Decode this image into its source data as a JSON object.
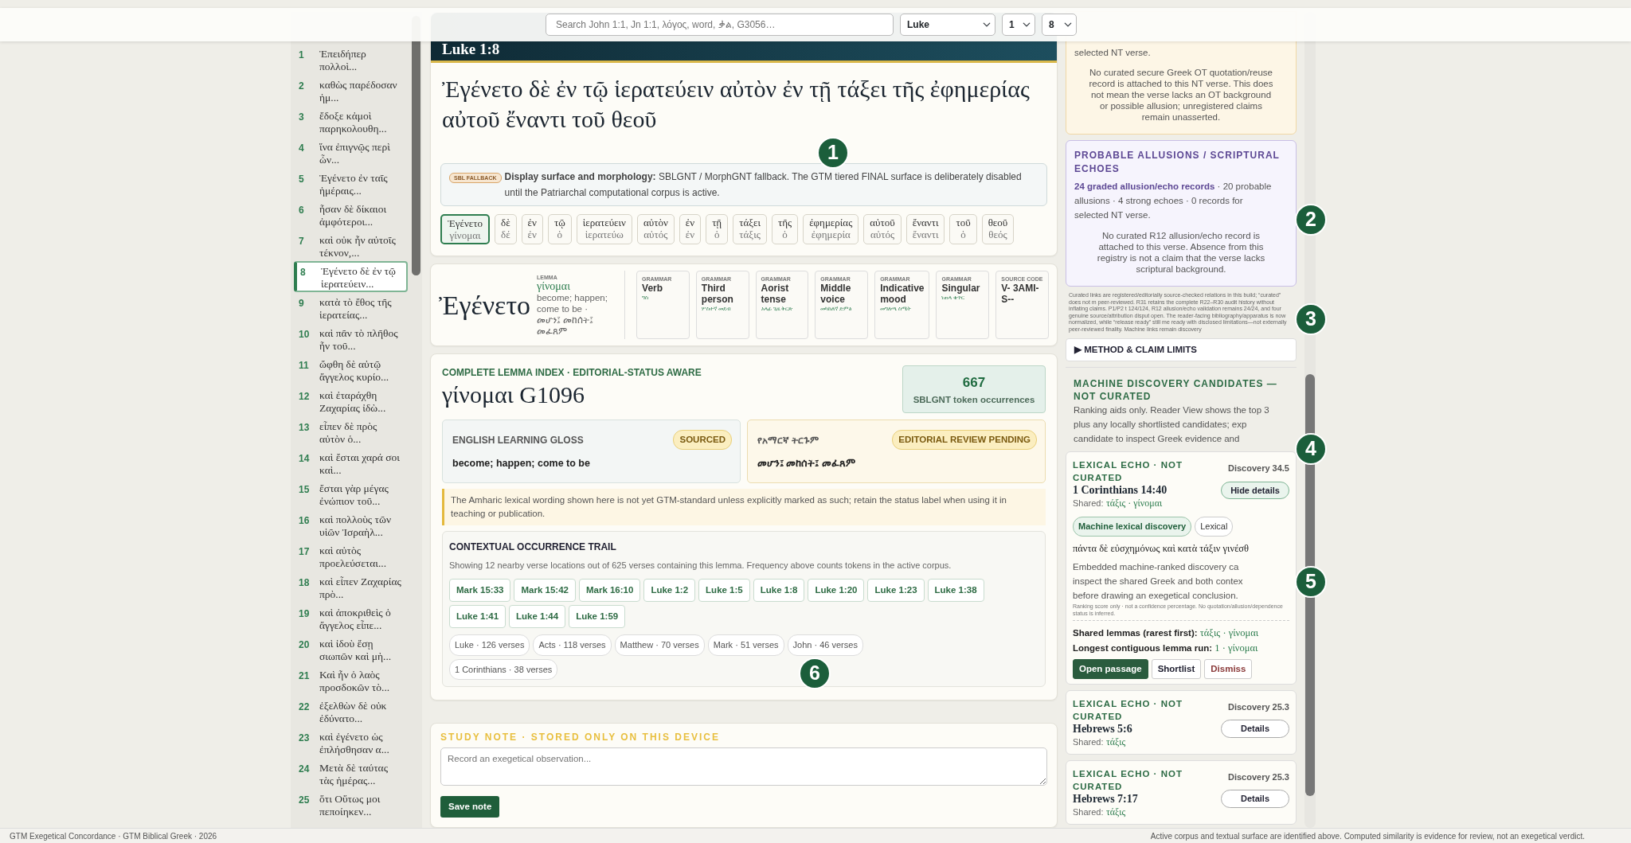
{
  "top_bar": {
    "search": {
      "placeholder": "Search John 1:1, Jn 1:1, λόγος, word, ቃል, G3056…"
    },
    "book": "Luke",
    "chapter": "1",
    "verse": "8"
  },
  "sidebar": {
    "verses": [
      {
        "number": "1",
        "text": "Ἐπειδήπερ πολλοὶ...",
        "selected": false
      },
      {
        "number": "2",
        "text": "καθὼς παρέδοσαν ἡμ...",
        "selected": false
      },
      {
        "number": "3",
        "text": "ἔδοξε κἀμοὶ παρηκολουθη...",
        "selected": false
      },
      {
        "number": "4",
        "text": "ἵνα ἐπιγνῷς περὶ ὧν...",
        "selected": false
      },
      {
        "number": "5",
        "text": "Ἐγένετο ἐν ταῖς ἡμέραις...",
        "selected": false
      },
      {
        "number": "6",
        "text": "ἦσαν δὲ δίκαιοι ἀμφότεροι...",
        "selected": false
      },
      {
        "number": "7",
        "text": "καὶ οὐκ ἦν αὐτοῖς τέκνον,...",
        "selected": false
      },
      {
        "number": "8",
        "text": "Ἐγένετο δὲ ἐν τῷ ἱερατεύειν...",
        "selected": true
      },
      {
        "number": "9",
        "text": "κατὰ τὸ ἔθος τῆς ἱερατείας...",
        "selected": false
      },
      {
        "number": "10",
        "text": "καὶ πᾶν τὸ πλῆθος ἦν τοῦ...",
        "selected": false
      },
      {
        "number": "11",
        "text": "ὤφθη δὲ αὐτῷ ἄγγελος κυρίο...",
        "selected": false
      },
      {
        "number": "12",
        "text": "καὶ ἐταράχθη Ζαχαρίας ἰδὼ...",
        "selected": false
      },
      {
        "number": "13",
        "text": "εἶπεν δὲ πρὸς αὐτὸν ὁ...",
        "selected": false
      },
      {
        "number": "14",
        "text": "καὶ ἔσται χαρά σοι καὶ...",
        "selected": false
      },
      {
        "number": "15",
        "text": "ἔσται γὰρ μέγας ἐνώπιον τοῦ...",
        "selected": false
      },
      {
        "number": "16",
        "text": "καὶ πολλοὺς τῶν υἱῶν Ἰσραὴλ...",
        "selected": false
      },
      {
        "number": "17",
        "text": "καὶ αὐτὸς προελεύσεται...",
        "selected": false
      },
      {
        "number": "18",
        "text": "καὶ εἶπεν Ζαχαρίας πρὸ...",
        "selected": false
      },
      {
        "number": "19",
        "text": "καὶ ἀποκριθεὶς ὁ ἄγγελος εἶπε...",
        "selected": false
      },
      {
        "number": "20",
        "text": "καὶ ἰδοὺ ἔσῃ σιωπῶν καὶ μὴ...",
        "selected": false
      },
      {
        "number": "21",
        "text": "Καὶ ἦν ὁ λαὸς προσδοκῶν τὸ...",
        "selected": false
      },
      {
        "number": "22",
        "text": "ἐξελθὼν δὲ οὐκ ἐδύνατο...",
        "selected": false
      },
      {
        "number": "23",
        "text": "καὶ ἐγένετο ὡς ἐπλήσθησαν α...",
        "selected": false
      },
      {
        "number": "24",
        "text": "Μετὰ δὲ ταύτας τὰς ἡμέρας...",
        "selected": false
      },
      {
        "number": "25",
        "text": "ὅτι Οὕτως μοι πεποίηκεν...",
        "selected": false
      }
    ]
  },
  "passage": {
    "reference": "Luke 1:8",
    "greek": "Ἐγένετο δὲ ἐν τῷ ἱερατεύειν αὐτὸν ἐν τῇ τάξει τῆς ἐφημερίας αὐτοῦ ἔναντι τοῦ θεοῦ",
    "notice": {
      "badge": "SBL FALLBACK",
      "text": "**Display surface and morphology:** SBLGNT / MorphGNT fallback. The GTM tiered FINAL surface is deliberately disabled until the Patriarchal computational corpus is active."
    },
    "words": [
      {
        "form": "Ἐγένετο",
        "lemma": "γίνομαι",
        "selected": true
      },
      {
        "form": "δὲ",
        "lemma": "δέ",
        "selected": false
      },
      {
        "form": "ἐν",
        "lemma": "ἐν",
        "selected": false
      },
      {
        "form": "τῷ",
        "lemma": "ὁ",
        "selected": false
      },
      {
        "form": "ἱερατεύειν",
        "lemma": "ἱερατεύω",
        "selected": false
      },
      {
        "form": "αὐτὸν",
        "lemma": "αὐτός",
        "selected": false
      },
      {
        "form": "ἐν",
        "lemma": "ἐν",
        "selected": false
      },
      {
        "form": "τῇ",
        "lemma": "ὁ",
        "selected": false
      },
      {
        "form": "τάξει",
        "lemma": "τάξις",
        "selected": false
      },
      {
        "form": "τῆς",
        "lemma": "ὁ",
        "selected": false
      },
      {
        "form": "ἐφημερίας",
        "lemma": "ἐφημερία",
        "selected": false
      },
      {
        "form": "αὐτοῦ",
        "lemma": "αὐτός",
        "selected": false
      },
      {
        "form": "ἔναντι",
        "lemma": "ἔναντι",
        "selected": false
      },
      {
        "form": "τοῦ",
        "lemma": "ὁ",
        "selected": false
      },
      {
        "form": "θεοῦ",
        "lemma": "θεός",
        "selected": false
      }
    ]
  },
  "morphology": {
    "word": "Ἐγένετο",
    "lemma_label": "LEMMA",
    "lemma": "γίνομαι",
    "gloss": "become; happen; come to be · መሆን፤ መከሰት፤ መፈጸም",
    "fields": [
      {
        "label": "GRAMMAR",
        "value": "Verb",
        "amharic": "ግስ"
      },
      {
        "label": "GRAMMAR",
        "value": "Third person",
        "amharic": "ሦስተኛ መደብ"
      },
      {
        "label": "GRAMMAR",
        "value": "Aorist tense",
        "amharic": "አላፊ ጊዜ ቅርጽ"
      },
      {
        "label": "GRAMMAR",
        "value": "Middle voice",
        "amharic": "መካከለኛ ድምፅ"
      },
      {
        "label": "GRAMMAR",
        "value": "Indicative mood",
        "amharic": "መግለጫ ስሜት"
      },
      {
        "label": "GRAMMAR",
        "value": "Singular",
        "amharic": "ነጠላ ቁጥር"
      },
      {
        "label": "SOURCE CODE",
        "value": "V- 3AMI-S--"
      }
    ]
  },
  "lemma_index": {
    "eyebrow": "COMPLETE LEMMA INDEX · EDITORIAL-STATUS AWARE",
    "lemma": "γίνομαι G1096",
    "count": "667",
    "count_label": "SBLGNT token occurrences",
    "glosses": [
      {
        "kind": "english",
        "label": "ENGLISH LEARNING GLOSS",
        "status": "SOURCED",
        "text": "become; happen; come to be"
      },
      {
        "kind": "amharic",
        "label": "የአማርኛ ትርጉም",
        "status": "EDITORIAL REVIEW PENDING",
        "text": "መሆን፤ መከሰት፤ መፈጸም"
      }
    ],
    "warning": "The Amharic lexical wording shown here is not yet GTM-standard unless explicitly marked as such; retain the status label when using it in teaching or publication.",
    "trail": {
      "title": "CONTEXTUAL OCCURRENCE TRAIL",
      "summary": "Showing 12 nearby verse locations out of 625 verses containing this lemma. Frequency above counts tokens in the active corpus.",
      "locations": [
        "Mark 15:33",
        "Mark 15:42",
        "Mark 16:10",
        "Luke 1:2",
        "Luke 1:5",
        "Luke 1:8",
        "Luke 1:20",
        "Luke 1:23",
        "Luke 1:38",
        "Luke 1:41",
        "Luke 1:44",
        "Luke 1:59"
      ],
      "books": [
        "Luke · 126 verses",
        "Acts · 118 verses",
        "Matthew · 70 verses",
        "Mark · 51 verses",
        "John · 46 verses",
        "1 Corinthians · 38 verses"
      ]
    }
  },
  "study_note": {
    "title": "STUDY NOTE · STORED ONLY ON THIS DEVICE",
    "placeholder": "Record an exegetical observation...",
    "button": "Save note"
  },
  "quotations": {
    "lead": "selected NT verse.",
    "note": "No curated secure Greek OT quotation/reuse record is attached to this NT verse. This does not mean the verse lacks an OT background or possible allusion; unregistered claims remain unasserted."
  },
  "allusions": {
    "title": "PROBABLE ALLUSIONS / SCRIPTURAL ECHOES",
    "summary": "**24 graded allusion/echo records** · 20 probable\nallusions · 4 strong echoes · 0 records for\nselected NT verse.",
    "note": "No curated R12 allusion/echo record is attached to this verse. Absence from this registry is not a claim that the verse lacks scriptural background."
  },
  "fine_print": "Curated links are registered/editorially source-checked relations in this build; “curated” does not m peer-reviewed. R31 retains the complete R22–R30 audit history without inflating claims. P1/P2 t 124/124, R12 allusion/echo validation remains 24/24, and four genuine source/attribution disput open. The reader-facing bibliography/apparatus is now normalized, while “release ready” still me ready with disclosed limitations—not externally peer-reviewed finality. Machine links remain discovery",
  "method": {
    "label": "▶ METHOD & CLAIM LIMITS"
  },
  "discovery": {
    "title": "MACHINE DISCOVERY CANDIDATES — NOT CURATED",
    "intro": "Ranking aids only. Reader View shows the top 3\nplus any locally shortlisted candidates; exp\ncandidate to inspect Greek evidence and",
    "candidates": [
      {
        "label": "LEXICAL ECHO · NOT CURATED",
        "score": "Discovery 34.5",
        "reference": "1 Corinthians 14:40",
        "shared_label": "Shared:",
        "shared": "τάξις · γίνομαι",
        "toggle": "Hide details",
        "expanded": true,
        "tags": [
          {
            "label": "Machine lexical discovery",
            "kind": "machine"
          },
          {
            "label": "Lexical",
            "kind": "plain"
          }
        ],
        "greek": "πάντα δὲ εὐσχημόνως καὶ κατὰ τάξιν γινέσθ",
        "explanation": "Embedded machine-ranked discovery ca\ninspect the shared Greek and both contex\nbefore drawing an exegetical conclusion.",
        "fine": "Ranking score only · not a confidence percentage. No quotation/allusion/dependence status is inferred.",
        "rows": [
          {
            "label": "Shared lemmas (rarest first):",
            "value": "τάξις · γίνομαι"
          },
          {
            "label": "Longest contiguous lemma run:",
            "value": "1 · γίνομαι"
          }
        ],
        "actions": [
          {
            "label": "Open passage",
            "kind": "primary"
          },
          {
            "label": "Shortlist",
            "kind": "plain"
          },
          {
            "label": "Dismiss",
            "kind": "danger"
          }
        ]
      },
      {
        "label": "LEXICAL ECHO · NOT CURATED",
        "score": "Discovery 25.3",
        "reference": "Hebrews 5:6",
        "shared_label": "Shared:",
        "shared": "τάξις",
        "toggle": "Details",
        "expanded": false
      },
      {
        "label": "LEXICAL ECHO · NOT CURATED",
        "score": "Discovery 25.3",
        "reference": "Hebrews 7:17",
        "shared_label": "Shared:",
        "shared": "τάξις",
        "toggle": "Details",
        "expanded": false
      }
    ]
  },
  "footer": {
    "left": "GTM Exegetical Concordance · GTM Biblical Greek · 2026",
    "right": "Active corpus and textual surface are identified above. Computed similarity is evidence for review, not an exegetical verdict."
  },
  "callouts": [
    "1",
    "2",
    "3",
    "4",
    "5",
    "6"
  ]
}
